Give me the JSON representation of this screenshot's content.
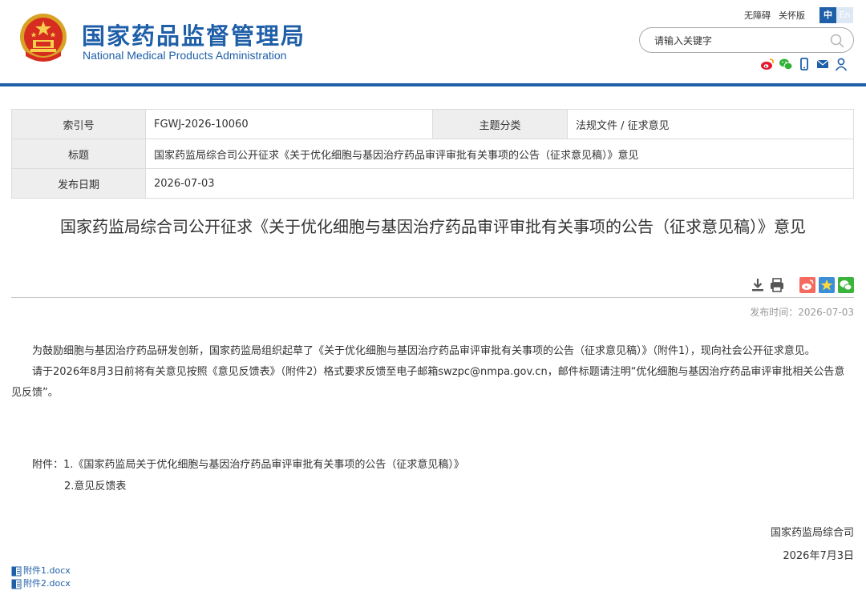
{
  "header": {
    "logo_cn": "国家药品监督管理局",
    "logo_en": "National Medical Products Administration",
    "accessibility": "无障碍",
    "elderly": "关怀版",
    "lang_zh": "中",
    "lang_en": "En",
    "search_placeholder": "请输入关键字",
    "brand_color": "#1f5fa8",
    "icons": [
      "weibo-icon",
      "wechat-icon",
      "mobile-icon",
      "mail-icon",
      "user-icon"
    ]
  },
  "info": {
    "index_label": "索引号",
    "index_value": "FGWJ-2026-10060",
    "category_label": "主题分类",
    "category_value": "法规文件 / 征求意见",
    "title_label": "标题",
    "title_value": "国家药监局综合司公开征求《关于优化细胞与基因治疗药品审评审批有关事项的公告（征求意见稿）》意见",
    "date_label": "发布日期",
    "date_value": "2026-07-03"
  },
  "article": {
    "title": "国家药监局综合司公开征求《关于优化细胞与基因治疗药品审评审批有关事项的公告（征求意见稿）》意见",
    "pubtime": "发布时间：2026-07-03",
    "para1": "为鼓励细胞与基因治疗药品研发创新，国家药监局组织起草了《关于优化细胞与基因治疗药品审评审批有关事项的公告（征求意见稿）》（附件1），现向社会公开征求意见。",
    "para2": "请于2026年8月3日前将有关意见按照《意见反馈表》（附件2）格式要求反馈至电子邮箱swzpc@nmpa.gov.cn，邮件标题请注明“优化细胞与基因治疗药品审评审批相关公告意见反馈”。",
    "attach1": "附件：1.《国家药监局关于优化细胞与基因治疗药品审评审批有关事项的公告（征求意见稿）》",
    "attach2": "2.意见反馈表",
    "sign_org": "国家药监局综合司",
    "sign_date": "2026年7月3日",
    "file1": "附件1.docx",
    "file2": "附件2.docx"
  }
}
